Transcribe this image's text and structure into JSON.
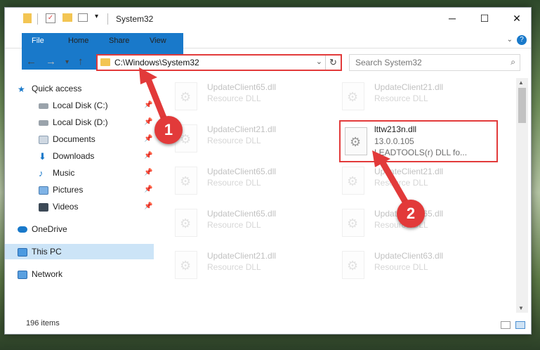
{
  "window": {
    "title": "System32"
  },
  "ribbon": {
    "tabs": [
      "File",
      "Home",
      "Share",
      "View"
    ],
    "help": "?"
  },
  "address": {
    "path": "C:\\Windows\\System32"
  },
  "search": {
    "placeholder": "Search System32"
  },
  "sidebar": {
    "items": [
      {
        "label": "Quick access",
        "icon": "star-icon"
      },
      {
        "label": "Local Disk (C:)",
        "icon": "drive-icon"
      },
      {
        "label": "Local Disk (D:)",
        "icon": "drive-icon"
      },
      {
        "label": "Documents",
        "icon": "documents-icon"
      },
      {
        "label": "Downloads",
        "icon": "download-icon"
      },
      {
        "label": "Music",
        "icon": "music-icon"
      },
      {
        "label": "Pictures",
        "icon": "pictures-icon"
      },
      {
        "label": "Videos",
        "icon": "videos-icon"
      },
      {
        "label": "OneDrive",
        "icon": "cloud-icon"
      },
      {
        "label": "This PC",
        "icon": "computer-icon"
      },
      {
        "label": "Network",
        "icon": "network-icon"
      }
    ]
  },
  "files": [
    {
      "name": "UpdateClient65.dll",
      "type": "Resource DLL"
    },
    {
      "name": "UpdateClient21.dll",
      "type": "Resource DLL"
    },
    {
      "name": "UpdateClient21.dll",
      "type": "Resource DLL"
    },
    {
      "name": "lttw213n.dll",
      "version": "13.0.0.105",
      "type": "LEADTOOLS(r) DLL fo..."
    },
    {
      "name": "UpdateClient65.dll",
      "type": "Resource DLL"
    },
    {
      "name": "UpdateClient21.dll",
      "type": "Resource DLL"
    },
    {
      "name": "UpdateClient65.dll",
      "type": "Resource DLL"
    },
    {
      "name": "UpdateClient65.dll",
      "type": "Resource DLL"
    },
    {
      "name": "UpdateClient21.dll",
      "type": "Resource DLL"
    },
    {
      "name": "UpdateClient63.dll",
      "type": "Resource DLL"
    }
  ],
  "status": {
    "count": "196 items"
  },
  "callouts": {
    "one": "1",
    "two": "2"
  },
  "colors": {
    "accent": "#1979ca",
    "highlight": "#e23a3a"
  }
}
